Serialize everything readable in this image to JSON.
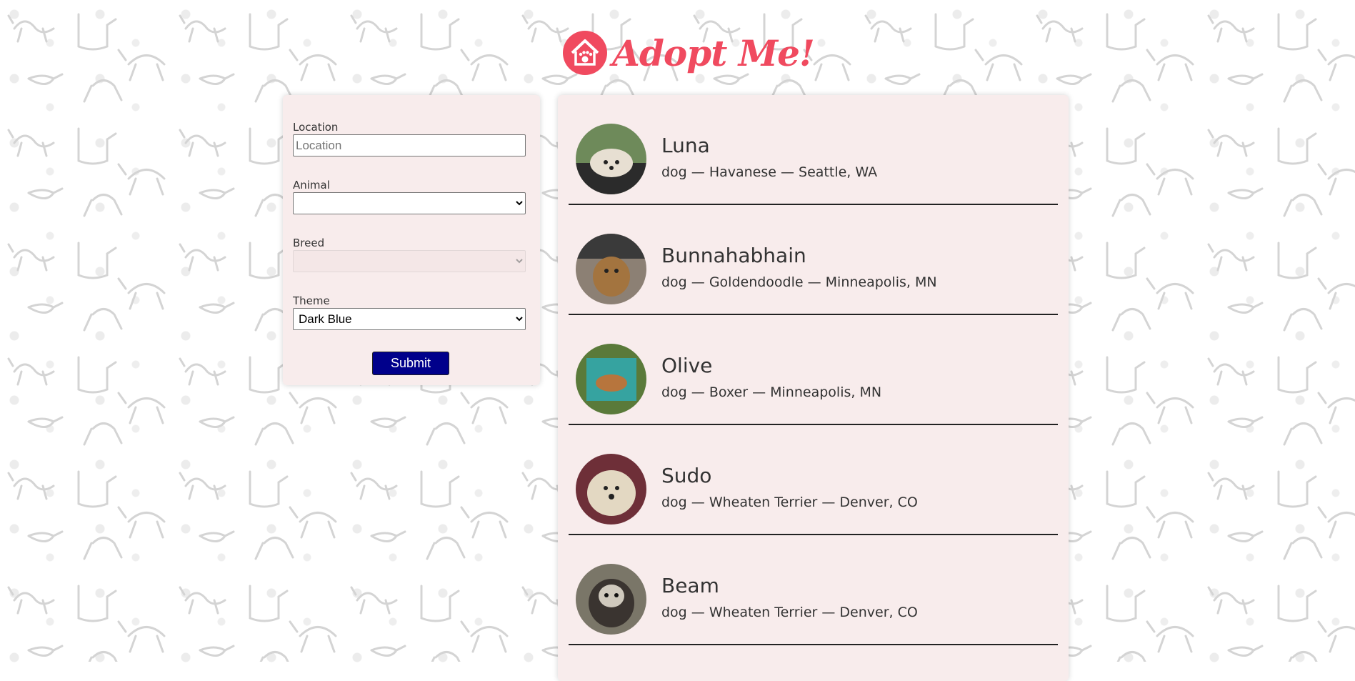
{
  "brand": {
    "title": "Adopt Me!",
    "accent": "#f04a5f"
  },
  "search": {
    "location": {
      "label": "Location",
      "placeholder": "Location",
      "value": ""
    },
    "animal": {
      "label": "Animal",
      "value": ""
    },
    "breed": {
      "label": "Breed",
      "value": "",
      "disabled": true
    },
    "theme": {
      "label": "Theme",
      "value": "Dark Blue",
      "color": "#00008b"
    },
    "submit_label": "Submit"
  },
  "pets": [
    {
      "name": "Luna",
      "info": "dog — Havanese — Seattle, WA",
      "photo": "havanese-photo"
    },
    {
      "name": "Bunnahabhain",
      "info": "dog — Goldendoodle — Minneapolis, MN",
      "photo": "goldendoodle-photo"
    },
    {
      "name": "Olive",
      "info": "dog — Boxer — Minneapolis, MN",
      "photo": "boxer-photo"
    },
    {
      "name": "Sudo",
      "info": "dog — Wheaten Terrier — Denver, CO",
      "photo": "wheaten-terrier-photo"
    },
    {
      "name": "Beam",
      "info": "dog — Wheaten Terrier — Denver, CO",
      "photo": "wheaten-terrier-photo"
    }
  ]
}
